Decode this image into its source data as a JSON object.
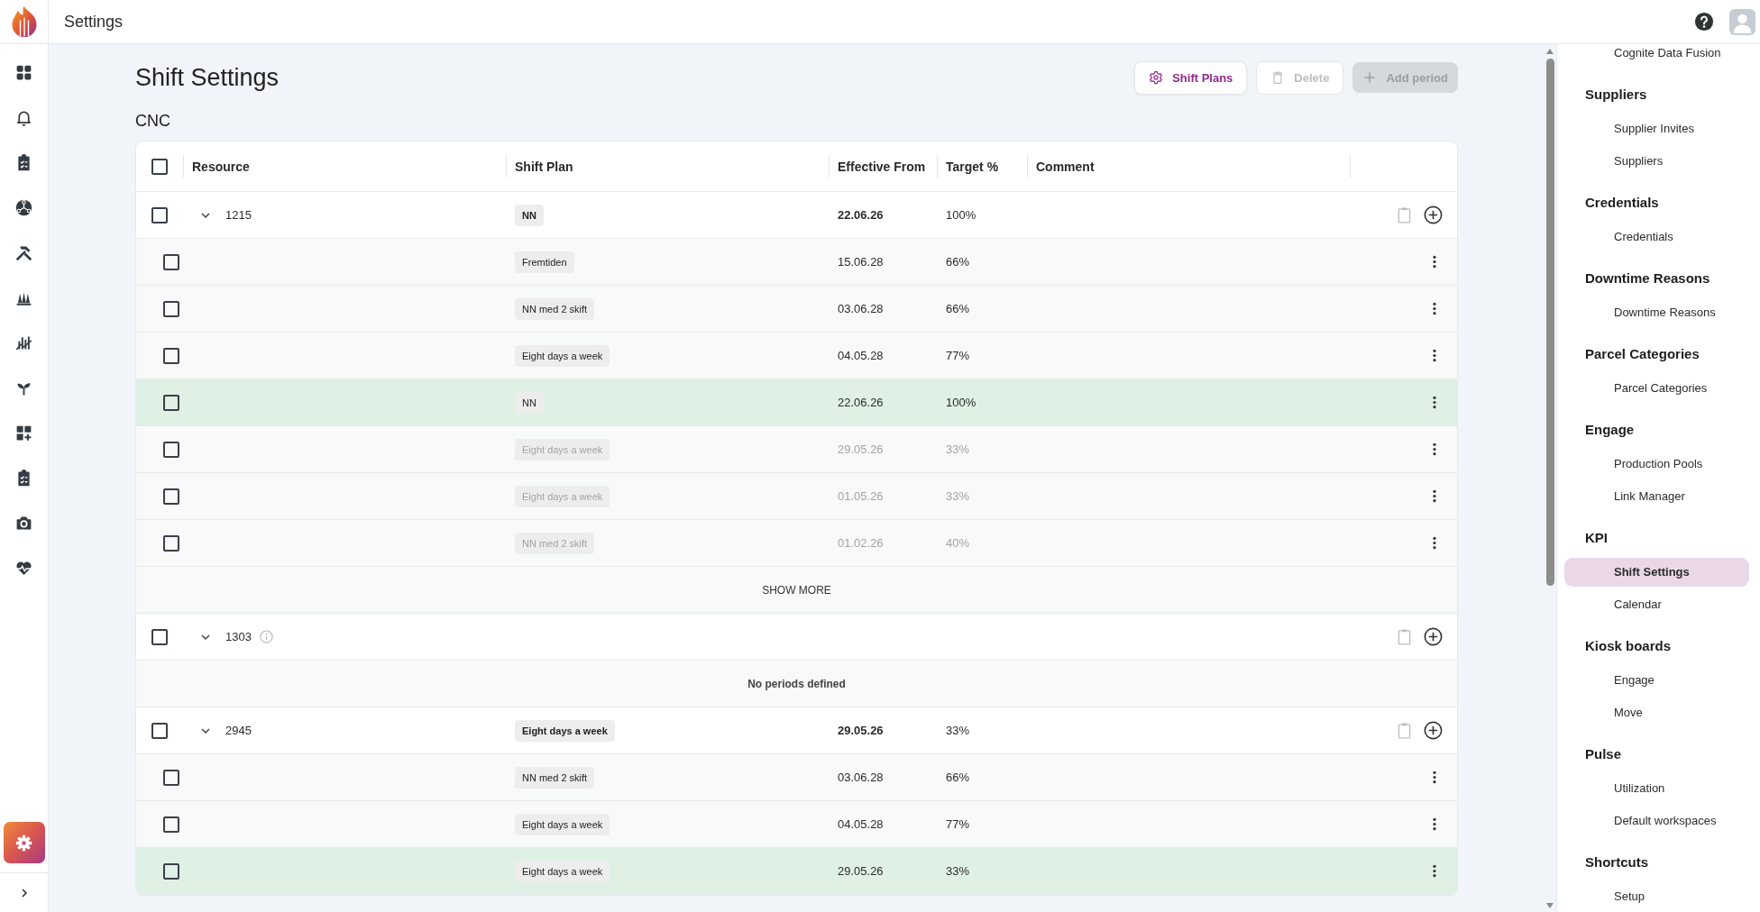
{
  "app_bar": {
    "title": "Settings"
  },
  "nav_rail": {
    "items": [
      {
        "selected": false
      },
      {
        "selected": false
      },
      {
        "selected": false
      },
      {
        "selected": false
      },
      {
        "selected": false
      },
      {
        "selected": false
      },
      {
        "selected": false
      },
      {
        "selected": false
      },
      {
        "selected": false
      },
      {
        "selected": false
      },
      {
        "selected": false
      },
      {
        "selected": false
      }
    ],
    "settings": {
      "selected": true
    }
  },
  "page": {
    "title": "Shift Settings",
    "section": "CNC",
    "actions": [
      {
        "label": "Shift Plans",
        "kind": "secondary",
        "disabled": false
      },
      {
        "label": "Delete",
        "kind": "secondary",
        "disabled": true
      },
      {
        "label": "Add period",
        "kind": "primary",
        "disabled": true
      }
    ]
  },
  "table": {
    "select_all_checked": false,
    "columns": [
      "Resource",
      "Shift Plan",
      "Effective From",
      "Target %",
      "Comment"
    ],
    "groups": [
      {
        "resource": "1215",
        "checked": false,
        "expanded": true,
        "info": false,
        "shift_plan": "NN",
        "effective_from": "22.06.26",
        "target": "100%",
        "periods": [
          {
            "checked": false,
            "shift_plan": "Fremtiden",
            "effective_from": "15.06.28",
            "target": "66%",
            "active": false,
            "past": false
          },
          {
            "checked": false,
            "shift_plan": "NN med 2 skift",
            "effective_from": "03.06.28",
            "target": "66%",
            "active": false,
            "past": false
          },
          {
            "checked": false,
            "shift_plan": "Eight days a week",
            "effective_from": "04.05.28",
            "target": "77%",
            "active": false,
            "past": false
          },
          {
            "checked": false,
            "shift_plan": "NN",
            "effective_from": "22.06.26",
            "target": "100%",
            "active": true,
            "past": false
          },
          {
            "checked": false,
            "shift_plan": "Eight days a week",
            "effective_from": "29.05.26",
            "target": "33%",
            "active": false,
            "past": true
          },
          {
            "checked": false,
            "shift_plan": "Eight days a week",
            "effective_from": "01.05.26",
            "target": "33%",
            "active": false,
            "past": true
          },
          {
            "checked": false,
            "shift_plan": "NN med 2 skift",
            "effective_from": "01.02.26",
            "target": "40%",
            "active": false,
            "past": true
          }
        ],
        "show_more": "SHOW MORE"
      },
      {
        "resource": "1303",
        "checked": false,
        "expanded": true,
        "info": true,
        "empty_text": "No periods defined"
      },
      {
        "resource": "2945",
        "checked": false,
        "expanded": true,
        "info": false,
        "shift_plan": "Eight days a week",
        "effective_from": "29.05.26",
        "target": "33%",
        "periods": [
          {
            "checked": false,
            "shift_plan": "NN med 2 skift",
            "effective_from": "03.06.28",
            "target": "66%",
            "active": false,
            "past": false
          },
          {
            "checked": false,
            "shift_plan": "Eight days a week",
            "effective_from": "04.05.28",
            "target": "77%",
            "active": false,
            "past": false
          },
          {
            "checked": false,
            "shift_plan": "Eight days a week",
            "effective_from": "29.05.26",
            "target": "33%",
            "active": true,
            "past": false
          }
        ]
      }
    ]
  },
  "settings_nav": {
    "groups": [
      {
        "items": [
          {
            "label": "Cognite Data Fusion",
            "selected": false
          }
        ]
      },
      {
        "title": "Suppliers",
        "items": [
          {
            "label": "Supplier Invites",
            "selected": false
          },
          {
            "label": "Suppliers",
            "selected": false
          }
        ]
      },
      {
        "title": "Credentials",
        "items": [
          {
            "label": "Credentials",
            "selected": false
          }
        ]
      },
      {
        "title": "Downtime Reasons",
        "items": [
          {
            "label": "Downtime Reasons",
            "selected": false
          }
        ]
      },
      {
        "title": "Parcel Categories",
        "items": [
          {
            "label": "Parcel Categories",
            "selected": false
          }
        ]
      },
      {
        "title": "Engage",
        "items": [
          {
            "label": "Production Pools",
            "selected": false
          },
          {
            "label": "Link Manager",
            "selected": false
          }
        ]
      },
      {
        "title": "KPI",
        "items": [
          {
            "label": "Shift Settings",
            "selected": true
          },
          {
            "label": "Calendar",
            "selected": false
          }
        ]
      },
      {
        "title": "Kiosk boards",
        "items": [
          {
            "label": "Engage",
            "selected": false
          },
          {
            "label": "Move",
            "selected": false
          }
        ]
      },
      {
        "title": "Pulse",
        "items": [
          {
            "label": "Utilization",
            "selected": false
          },
          {
            "label": "Default workspaces",
            "selected": false
          }
        ]
      },
      {
        "title": "Shortcuts",
        "items": [
          {
            "label": "Setup",
            "selected": false
          }
        ]
      }
    ]
  }
}
